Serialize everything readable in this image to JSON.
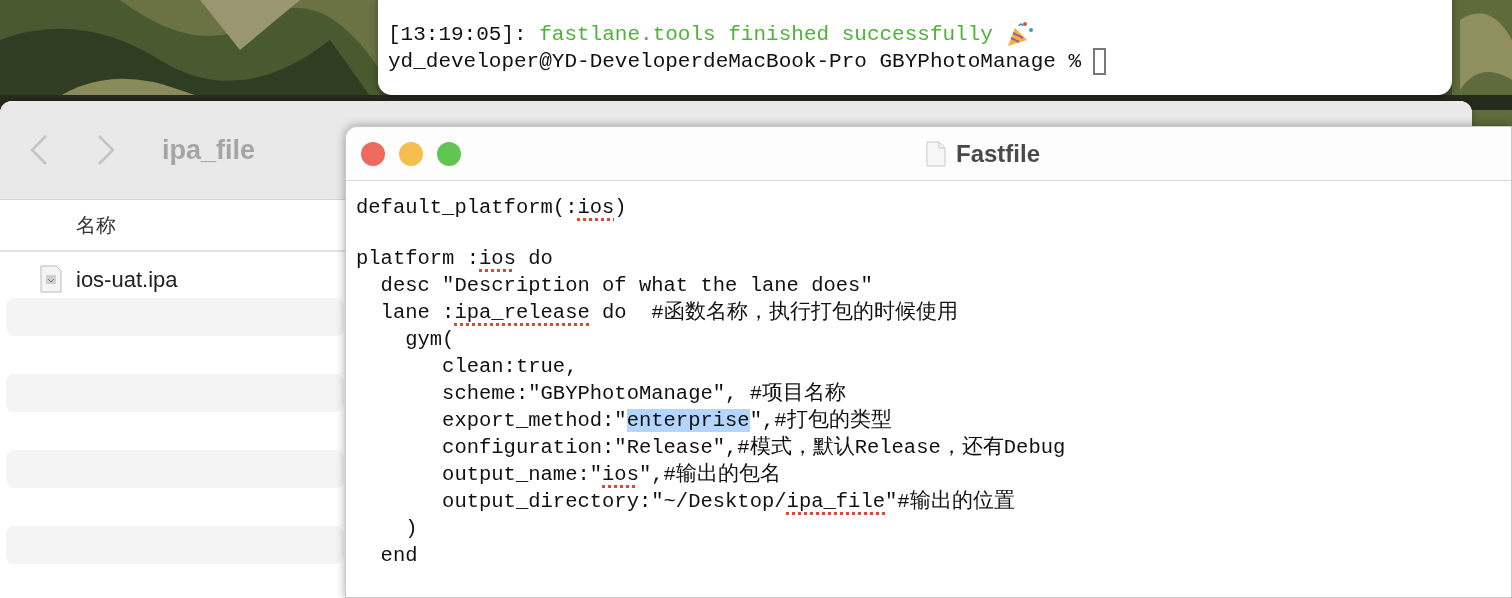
{
  "terminal": {
    "status_time": "[13:19:05]:",
    "status_message": "fastlane.tools finished successfully",
    "prompt": "yd_developer@YD-DeveloperdeMacBook-Pro GBYPhotoManage %"
  },
  "finder": {
    "title": "ipa_file",
    "column": "名称",
    "files": [
      {
        "name": "ios-uat.ipa"
      }
    ]
  },
  "editor": {
    "title": "Fastfile",
    "lines": [
      {
        "segments": [
          {
            "text": "default_platform(:",
            "kind": "plain"
          },
          {
            "text": "ios",
            "kind": "misspelled"
          },
          {
            "text": ")",
            "kind": "plain"
          }
        ]
      },
      {
        "blank_before": true,
        "segments": [
          {
            "text": "platform :",
            "kind": "plain"
          },
          {
            "text": "ios",
            "kind": "misspelled"
          },
          {
            "text": " do",
            "kind": "plain"
          }
        ]
      },
      {
        "segments": [
          {
            "text": "  desc \"Description of what the lane does\"",
            "kind": "plain"
          }
        ]
      },
      {
        "segments": [
          {
            "text": "  lane :",
            "kind": "plain"
          },
          {
            "text": "ipa_release",
            "kind": "misspelled"
          },
          {
            "text": " do  #函数名称，执行打包的时候使用",
            "kind": "plain"
          }
        ]
      },
      {
        "segments": [
          {
            "text": "    gym(",
            "kind": "plain"
          }
        ]
      },
      {
        "segments": [
          {
            "text": "       clean:true,",
            "kind": "plain"
          }
        ]
      },
      {
        "segments": [
          {
            "text": "       scheme:\"GBYPhotoManage\", #项目名称",
            "kind": "plain"
          }
        ]
      },
      {
        "segments": [
          {
            "text": "       export_method:\"",
            "kind": "plain"
          },
          {
            "text": "enterprise",
            "kind": "selected"
          },
          {
            "text": "\",#打包的类型",
            "kind": "plain"
          }
        ]
      },
      {
        "segments": [
          {
            "text": "       configuration:\"Release\",#模式，默认Release，还有Debug",
            "kind": "plain"
          }
        ]
      },
      {
        "segments": [
          {
            "text": "       output_name:\"",
            "kind": "plain"
          },
          {
            "text": "ios",
            "kind": "misspelled"
          },
          {
            "text": "\",#输出的包名",
            "kind": "plain"
          }
        ]
      },
      {
        "segments": [
          {
            "text": "       output_directory:\"~/Desktop/",
            "kind": "plain"
          },
          {
            "text": "ipa_file",
            "kind": "misspelled"
          },
          {
            "text": "\"#输出的位置",
            "kind": "plain"
          }
        ]
      },
      {
        "segments": [
          {
            "text": "    )",
            "kind": "plain"
          }
        ]
      },
      {
        "segments": [
          {
            "text": "  end",
            "kind": "plain"
          }
        ]
      }
    ]
  }
}
